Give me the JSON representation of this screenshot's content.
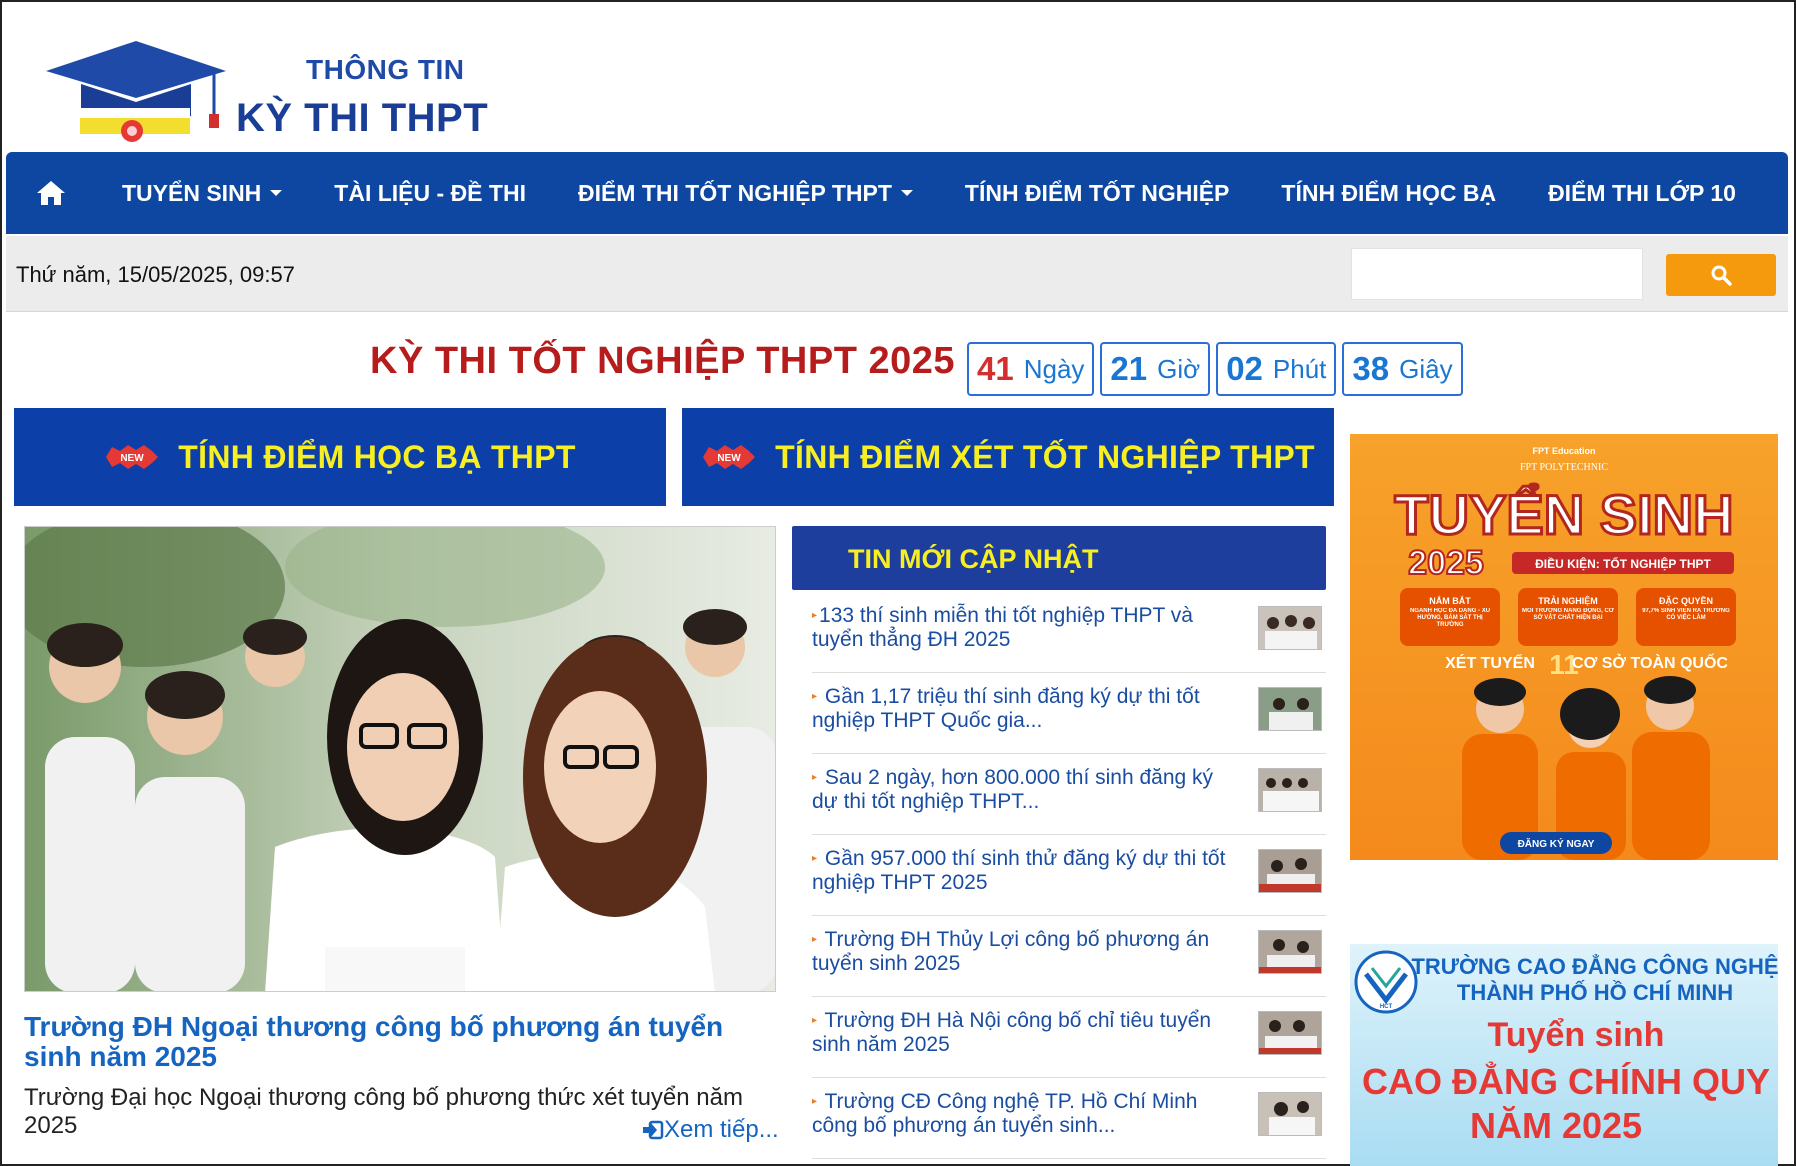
{
  "logo": {
    "line1": "THÔNG TIN",
    "line2": "KỲ THI THPT"
  },
  "nav": {
    "items": [
      {
        "label": "TUYỂN SINH",
        "dropdown": true
      },
      {
        "label": "TÀI LIỆU - ĐỀ THI",
        "dropdown": false
      },
      {
        "label": "ĐIỂM THI TỐT NGHIỆP THPT",
        "dropdown": true
      },
      {
        "label": "TÍNH ĐIỂM TỐT NGHIỆP",
        "dropdown": false
      },
      {
        "label": "TÍNH ĐIỂM HỌC BẠ",
        "dropdown": false
      },
      {
        "label": "ĐIỂM THI LỚP 10",
        "dropdown": false
      }
    ]
  },
  "infobar": {
    "datetime": "Thứ năm, 15/05/2025, 09:57",
    "search_value": ""
  },
  "countdown": {
    "title": "KỲ THI TỐT NGHIỆP THPT 2025",
    "days": "41",
    "days_label": "Ngày",
    "hours": "21",
    "hours_label": "Giờ",
    "minutes": "02",
    "minutes_label": "Phút",
    "seconds": "38",
    "seconds_label": "Giây"
  },
  "buttons": {
    "hocba": "TÍNH ĐIỂM HỌC BẠ THPT",
    "totnghiep": "TÍNH ĐIỂM XÉT TỐT NGHIỆP THPT",
    "badge": "NEW"
  },
  "featured": {
    "title": "Trường ĐH Ngoại thương công bố phương án tuyển sinh năm 2025",
    "desc": "Trường Đại học Ngoại thương công bố phương thức xét tuyển năm 2025",
    "more": "Xem tiếp..."
  },
  "news": {
    "heading": "TIN MỚI CẬP NHẬT",
    "items": [
      "133 thí sinh miễn thi tốt nghiệp THPT và tuyển thẳng ĐH 2025",
      "Gần 1,17 triệu thí sinh đăng ký dự thi tốt nghiệp THPT Quốc gia...",
      "Sau 2 ngày, hơn 800.000 thí sinh đăng ký dự thi tốt nghiệp THPT...",
      "Gần 957.000 thí sinh thử đăng ký dự thi tốt nghiệp THPT 2025",
      "Trường ĐH Thủy Lợi công bố phương án tuyển sinh 2025",
      "Trường ĐH Hà Nội công bố chỉ tiêu tuyển sinh năm 2025",
      "Trường CĐ Công nghệ TP. Hồ Chí Minh công bố phương án tuyển sinh..."
    ]
  },
  "ads": {
    "fpt": {
      "brand": "FPT Education",
      "school": "FPT POLYTECHNIC",
      "title": "TUYỂN SINH",
      "year": "2025",
      "condition": "ĐIỀU KIỆN: TỐT NGHIỆP THPT",
      "badge1": "NẮM BẮT",
      "badge2": "TRẢI NGHIỆM",
      "badge3": "ĐẶC QUYỀN",
      "badge1_text": "NGÀNH HỌC ĐA DẠNG - XU HƯỚNG, BÁM SÁT THỊ TRƯỜNG",
      "badge2_text": "MÔI TRƯỜNG NĂNG ĐỘNG, CƠ SỞ VẬT CHẤT HIỆN ĐẠI",
      "badge3_text": "97,7% SINH VIÊN RA TRƯỜNG CÓ VIỆC LÀM",
      "xettuyen": "XÉT TUYỂN",
      "count": "11",
      "coso": "CƠ SỞ TOÀN QUỐC",
      "cta": "ĐĂNG KÝ NGAY"
    },
    "hct": {
      "line1": "TRƯỜNG CAO ĐẲNG CÔNG NGHỆ",
      "line2": "THÀNH PHỐ HỒ CHÍ MINH",
      "line3": "Tuyển sinh",
      "line4": "CAO ĐẲNG CHÍNH QUY",
      "line5": "NĂM 2025",
      "logo": "HCT"
    }
  },
  "colors": {
    "nav": "#0d47a1",
    "accent_yellow": "#f8ef22",
    "search_btn": "#f59a0c",
    "title_red": "#b71c1c",
    "link_blue": "#1565c0"
  }
}
